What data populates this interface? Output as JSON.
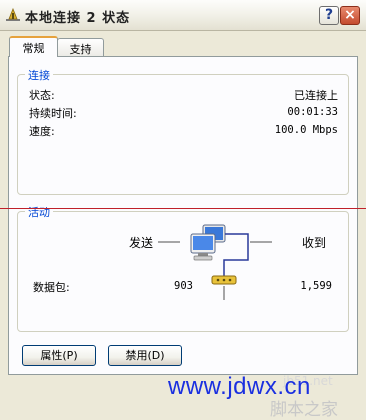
{
  "window": {
    "title": "本地连接 2 状态",
    "help_label": "?",
    "close_label": "×"
  },
  "tabs": [
    {
      "label": "常规",
      "selected": true
    },
    {
      "label": "支持",
      "selected": false
    }
  ],
  "connection": {
    "group_title": "连接",
    "status_label": "状态:",
    "status_value": "已连接上",
    "duration_label": "持续时间:",
    "duration_value": "00:01:33",
    "speed_label": "速度:",
    "speed_value": "100.0 Mbps"
  },
  "activity": {
    "group_title": "活动",
    "sent_label": "发送",
    "received_label": "收到",
    "packets_label": "数据包:",
    "packets_sent": "903",
    "packets_received": "1,599"
  },
  "buttons": {
    "properties": "属性(P)",
    "disable": "禁用(D)"
  },
  "watermark": {
    "url": "www.jdwx.cn",
    "brand": "脚本之家",
    "faint_text": "jb51.net"
  },
  "colors": {
    "accent": "#0046D5",
    "tab_highlight": "#E6A23C",
    "divider_line": "#C0202A",
    "watermark_url": "#1A2FE0"
  }
}
